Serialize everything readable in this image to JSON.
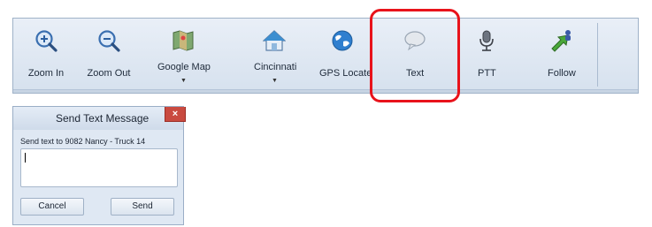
{
  "toolbar": {
    "items": [
      {
        "label": "Zoom In",
        "icon": "zoom-in-icon"
      },
      {
        "label": "Zoom Out",
        "icon": "zoom-out-icon"
      },
      {
        "label": "Google Map",
        "icon": "map-icon",
        "dropdown": true
      },
      {
        "label": "Cincinnati",
        "icon": "home-icon",
        "dropdown": true
      },
      {
        "label": "GPS Locate",
        "icon": "globe-icon"
      },
      {
        "label": "Text",
        "icon": "speech-bubble-icon"
      },
      {
        "label": "PTT",
        "icon": "microphone-icon"
      },
      {
        "label": "Follow",
        "icon": "follow-icon"
      }
    ]
  },
  "highlight_color": "#e8131b",
  "dialog": {
    "title": "Send Text Message",
    "close_label": "×",
    "prompt": "Send text to 9082 Nancy - Truck 14",
    "message_value": "",
    "cancel_label": "Cancel",
    "send_label": "Send"
  }
}
